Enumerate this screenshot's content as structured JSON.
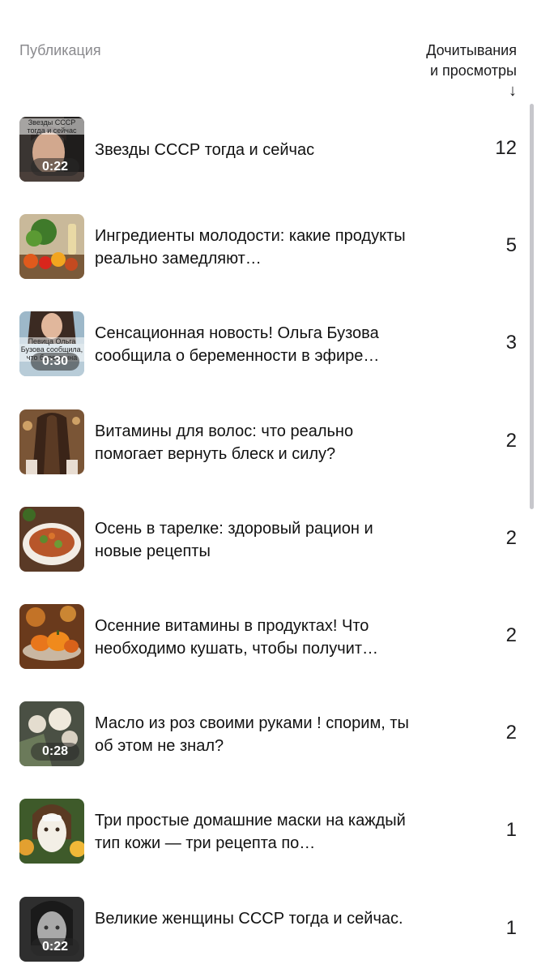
{
  "header": {
    "publication_label": "Публикация",
    "stat_label_line1": "Дочитывания",
    "stat_label_line2": "и просмотры",
    "sort_arrow": "↓"
  },
  "items": [
    {
      "title": "Звезды СССР тогда и сейчас",
      "count": "12",
      "duration": "0:22",
      "thumb_caption": "Звезды СССР тогда и сейчас",
      "icon": "portrait-thumbnail"
    },
    {
      "title": "Ингредиенты молодости: какие продукты реально замедляют…",
      "count": "5",
      "duration": "",
      "thumb_caption": "",
      "icon": "vegetables-thumbnail"
    },
    {
      "title": "Сенсационная новость! Ольга Бузова сообщила о беременности в эфире…",
      "count": "3",
      "duration": "0:30",
      "thumb_caption": "Певица Ольга Бузова сообщила, что беременна",
      "icon": "woman-thumbnail"
    },
    {
      "title": "Витамины для волос: что реально помогает вернуть блеск и силу?",
      "count": "2",
      "duration": "",
      "thumb_caption": "",
      "icon": "hair-thumbnail"
    },
    {
      "title": "Осень в тарелке: здоровый рацион и новые рецепты",
      "count": "2",
      "duration": "",
      "thumb_caption": "",
      "icon": "salad-thumbnail"
    },
    {
      "title": "Осенние витамины в продуктах! Что необходимо кушать, чтобы получит…",
      "count": "2",
      "duration": "",
      "thumb_caption": "",
      "icon": "pumpkin-thumbnail"
    },
    {
      "title": "Масло из роз своими руками ! спорим, ты об этом не знал?",
      "count": "2",
      "duration": "0:28",
      "thumb_caption": "",
      "icon": "roses-thumbnail"
    },
    {
      "title": "Три простые домашние маски на каждый тип кожи — три рецепта по…",
      "count": "1",
      "duration": "",
      "thumb_caption": "",
      "icon": "face-mask-thumbnail"
    },
    {
      "title": "Великие женщины СССР тогда и сейчас.",
      "count": "1",
      "duration": "0:22",
      "thumb_caption": "",
      "icon": "bw-portrait-thumbnail"
    }
  ]
}
